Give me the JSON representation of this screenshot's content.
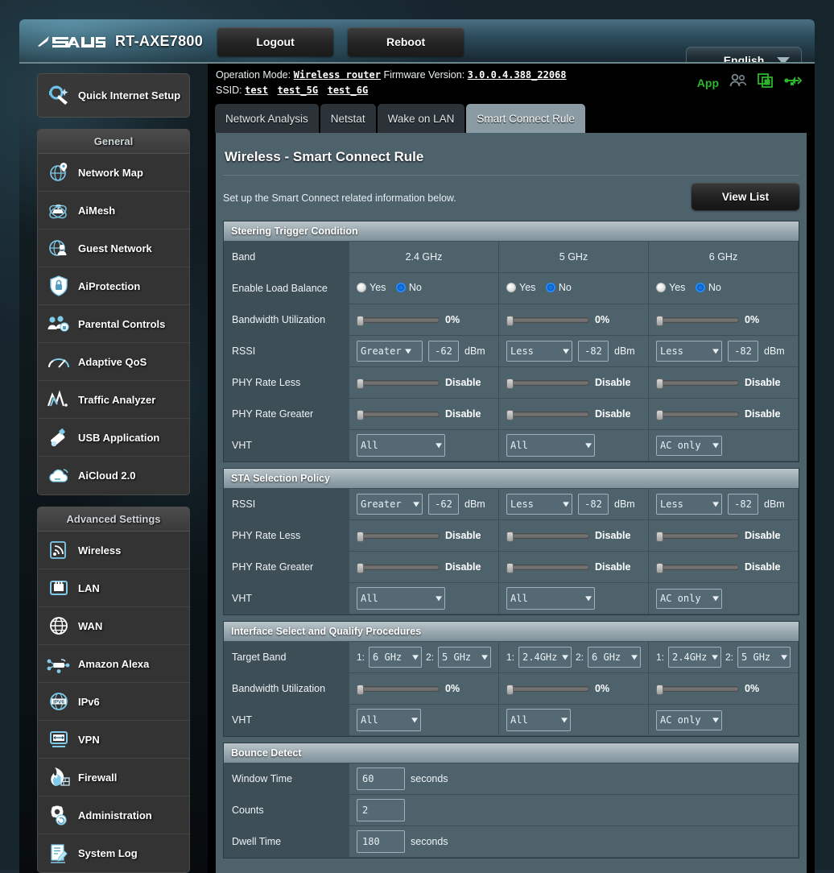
{
  "header": {
    "model": "RT-AXE7800",
    "logo_alt": "ASUS",
    "logout_label": "Logout",
    "reboot_label": "Reboot",
    "language": "English"
  },
  "infobar": {
    "operation_mode_label": "Operation Mode:",
    "operation_mode_value": "Wireless router",
    "firmware_label": "Firmware Version:",
    "firmware_value": "3.0.0.4.388_22068",
    "ssid_label": "SSID:",
    "ssids": [
      "test",
      "test_5G",
      "test_6G"
    ],
    "app_label": "App"
  },
  "sidebar": {
    "quick_internet_setup": "Quick Internet Setup",
    "general_title": "General",
    "general_items": [
      {
        "label": "Network Map",
        "icon": "network-map-icon"
      },
      {
        "label": "AiMesh",
        "icon": "aimesh-icon"
      },
      {
        "label": "Guest Network",
        "icon": "guest-network-icon"
      },
      {
        "label": "AiProtection",
        "icon": "aiprotection-icon"
      },
      {
        "label": "Parental Controls",
        "icon": "parental-controls-icon"
      },
      {
        "label": "Adaptive QoS",
        "icon": "adaptive-qos-icon"
      },
      {
        "label": "Traffic Analyzer",
        "icon": "traffic-analyzer-icon"
      },
      {
        "label": "USB Application",
        "icon": "usb-application-icon"
      },
      {
        "label": "AiCloud 2.0",
        "icon": "aicloud-icon"
      }
    ],
    "advanced_title": "Advanced Settings",
    "advanced_items": [
      {
        "label": "Wireless",
        "icon": "wireless-icon"
      },
      {
        "label": "LAN",
        "icon": "lan-icon"
      },
      {
        "label": "WAN",
        "icon": "wan-icon"
      },
      {
        "label": "Amazon Alexa",
        "icon": "amazon-alexa-icon"
      },
      {
        "label": "IPv6",
        "icon": "ipv6-icon"
      },
      {
        "label": "VPN",
        "icon": "vpn-icon"
      },
      {
        "label": "Firewall",
        "icon": "firewall-icon"
      },
      {
        "label": "Administration",
        "icon": "administration-icon"
      },
      {
        "label": "System Log",
        "icon": "system-log-icon"
      }
    ]
  },
  "tabs": [
    {
      "label": "Network Analysis",
      "active": false
    },
    {
      "label": "Netstat",
      "active": false
    },
    {
      "label": "Wake on LAN",
      "active": false
    },
    {
      "label": "Smart Connect Rule",
      "active": true
    }
  ],
  "main": {
    "page_title": "Wireless - Smart Connect Rule",
    "description": "Set up the Smart Connect related information below.",
    "view_list_label": "View List"
  },
  "steering": {
    "title": "Steering Trigger Condition",
    "band_label": "Band",
    "bands": [
      "2.4 GHz",
      "5 GHz",
      "6 GHz"
    ],
    "rows": {
      "load_balance_label": "Enable Load Balance",
      "load_balance": [
        {
          "yes": "Yes",
          "no": "No",
          "selected": "No"
        },
        {
          "yes": "Yes",
          "no": "No",
          "selected": "No"
        },
        {
          "yes": "Yes",
          "no": "No",
          "selected": "No"
        }
      ],
      "bandwidth_label": "Bandwidth Utilization",
      "bandwidth": [
        "0%",
        "0%",
        "0%"
      ],
      "rssi_label": "RSSI",
      "rssi": [
        {
          "op": "Greater",
          "value": "-62",
          "unit": "dBm"
        },
        {
          "op": "Less",
          "value": "-82",
          "unit": "dBm"
        },
        {
          "op": "Less",
          "value": "-82",
          "unit": "dBm"
        }
      ],
      "phy_less_label": "PHY Rate Less",
      "phy_less": [
        "Disable",
        "Disable",
        "Disable"
      ],
      "phy_greater_label": "PHY Rate Greater",
      "phy_greater": [
        "Disable",
        "Disable",
        "Disable"
      ],
      "vht_label": "VHT",
      "vht": [
        "All",
        "All",
        "AC only"
      ]
    }
  },
  "sta": {
    "title": "STA Selection Policy",
    "rows": {
      "rssi_label": "RSSI",
      "rssi": [
        {
          "op": "Greater",
          "value": "-62",
          "unit": "dBm"
        },
        {
          "op": "Less",
          "value": "-82",
          "unit": "dBm"
        },
        {
          "op": "Less",
          "value": "-82",
          "unit": "dBm"
        }
      ],
      "phy_less_label": "PHY Rate Less",
      "phy_less": [
        "Disable",
        "Disable",
        "Disable"
      ],
      "phy_greater_label": "PHY Rate Greater",
      "phy_greater": [
        "Disable",
        "Disable",
        "Disable"
      ],
      "vht_label": "VHT",
      "vht": [
        "All",
        "All",
        "AC only"
      ]
    }
  },
  "interface": {
    "title": "Interface Select and Qualify Procedures",
    "target_band_label": "Target Band",
    "target_bands": [
      {
        "i1": "1:",
        "v1": "6 GHz",
        "i2": "2:",
        "v2": "5 GHz"
      },
      {
        "i1": "1:",
        "v1": "2.4GHz",
        "i2": "2:",
        "v2": "6 GHz"
      },
      {
        "i1": "1:",
        "v1": "2.4GHz",
        "i2": "2:",
        "v2": "5 GHz"
      }
    ],
    "bandwidth_label": "Bandwidth Utilization",
    "bandwidth": [
      "0%",
      "0%",
      "0%"
    ],
    "vht_label": "VHT",
    "vht": [
      "All",
      "All",
      "AC only"
    ]
  },
  "bounce": {
    "title": "Bounce Detect",
    "window_time_label": "Window Time",
    "window_time_value": "60",
    "window_time_unit": "seconds",
    "counts_label": "Counts",
    "counts_value": "2",
    "dwell_time_label": "Dwell Time",
    "dwell_time_value": "180",
    "dwell_time_unit": "seconds"
  },
  "colors": {
    "accent_blue": "#1673e8",
    "app_green": "#2bb62b",
    "panel": "#4e626c",
    "label_cell": "#3d4e57"
  }
}
